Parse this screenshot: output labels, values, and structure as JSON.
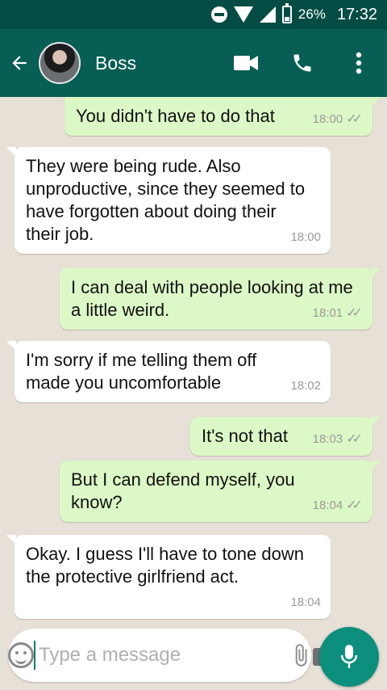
{
  "status_bar": {
    "battery": "26%",
    "time": "17:32"
  },
  "header": {
    "contact_name": "Boss"
  },
  "messages": [
    {
      "direction": "out",
      "text": "You didn't have to do that",
      "time": "18:00"
    },
    {
      "direction": "in",
      "text": "They were being rude. Also unproductive, since they seemed to have forgotten about doing their their job.",
      "time": "18:00"
    },
    {
      "direction": "out",
      "text": "I can deal with people looking at me a little weird.",
      "time": "18:01"
    },
    {
      "direction": "in",
      "text": "I'm sorry if me telling them off made you uncomfortable",
      "time": "18:02"
    },
    {
      "direction": "out",
      "text": "It's not that",
      "time": "18:03"
    },
    {
      "direction": "out",
      "text": "But I can defend myself, you know?",
      "time": "18:04"
    },
    {
      "direction": "in",
      "text": "Okay. I guess I'll have to tone down the protective girlfriend act.",
      "time": "18:04"
    }
  ],
  "composer": {
    "placeholder": "Type a message",
    "value": ""
  },
  "icons": {
    "back": "arrow-left-icon",
    "video": "video-camera-icon",
    "call": "phone-icon",
    "menu": "more-vert-icon",
    "emoji": "emoji-icon",
    "attach": "paperclip-icon",
    "camera": "camera-icon",
    "mic": "microphone-icon"
  },
  "colors": {
    "header": "#075e54",
    "status_bar": "#054d44",
    "outgoing_bubble": "#dcf8c6",
    "incoming_bubble": "#ffffff",
    "accent": "#0d8f7e"
  }
}
